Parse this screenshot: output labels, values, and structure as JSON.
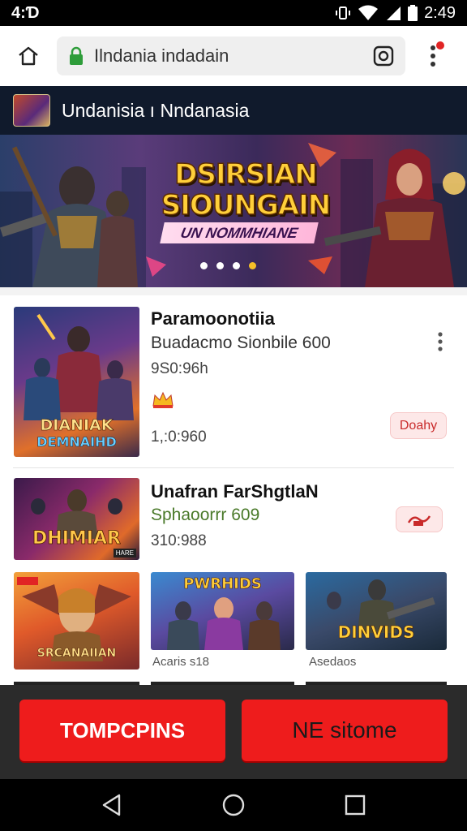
{
  "status_bar": {
    "time_left": "4:Ɗ",
    "time_right": "2:49",
    "icons": [
      "vibrate-icon",
      "wifi-icon",
      "signal-icon",
      "battery-icon"
    ]
  },
  "browser": {
    "url_text": "Ilndania indadain",
    "icons": [
      "home-icon",
      "lock-icon",
      "camera-icon",
      "menu-dots-icon"
    ]
  },
  "site": {
    "title": "Undanisia ı Nndanasia"
  },
  "banner": {
    "title_line1": "DSIRSIAN",
    "title_line2": "SIOUNGAIN",
    "subtitle": "UN NOMMHIANE",
    "slide_count": 4,
    "active_slide": 4
  },
  "cards": [
    {
      "title": "Paramoonotiia",
      "subtitle": "Buadacmo Sionbile 600",
      "meta": "9S0:96h",
      "date": "1,:0:960",
      "thumb_text_1": "DIANIAK",
      "thumb_text_2": "DEMNAIHD",
      "pill_label": "Doahy"
    },
    {
      "title": "Unafran FarShgtlaN",
      "subtitle": "Sphaoorrr 609",
      "meta": "310:988",
      "thumb_text": "DHIMIAR",
      "thumb_badge": "HARE"
    }
  ],
  "grid": [
    {
      "thumb_text": "SRCANAIIAN",
      "caption": ""
    },
    {
      "thumb_text": "PWRHIDS",
      "caption": "Acaris s18"
    },
    {
      "thumb_text": "DINVIDS",
      "caption": "Asedaos"
    }
  ],
  "buttons": {
    "primary": "TOMPCPINS",
    "secondary": "NE sitome"
  },
  "colors": {
    "accent_red": "#ee1c1c",
    "header_navy": "#101a2c",
    "banner_gold": "#ffcf3a"
  }
}
